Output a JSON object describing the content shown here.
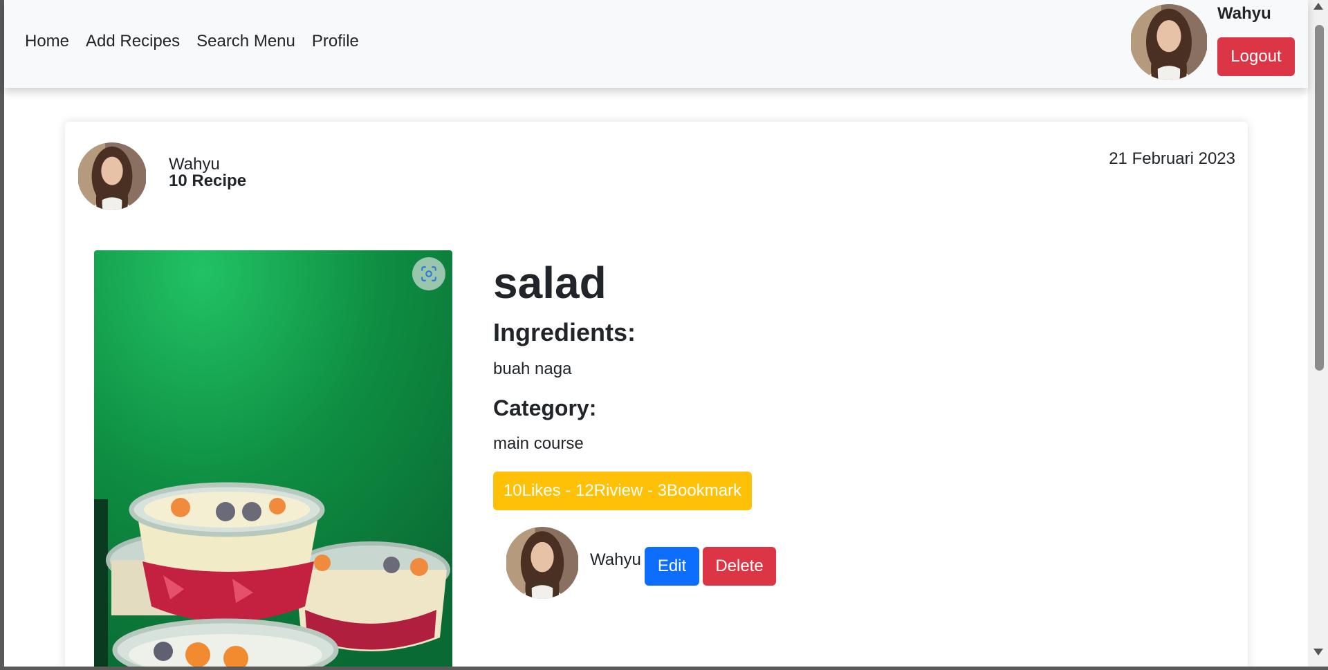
{
  "navbar": {
    "links": [
      "Home",
      "Add Recipes",
      "Search Menu",
      "Profile"
    ],
    "username": "Wahyu",
    "logout_label": "Logout"
  },
  "author": {
    "name": "Wahyu",
    "recipe_count": "10 Recipe",
    "date": "21 Februari 2023"
  },
  "recipe": {
    "title": "salad",
    "ingredients_heading": "Ingredients:",
    "ingredients": "buah naga",
    "category_heading": "Category:",
    "category": "main course",
    "stats": "10Likes - 12Riview - 3Bookmark"
  },
  "owner": {
    "name": "Wahyu",
    "edit_label": "Edit",
    "delete_label": "Delete"
  },
  "colors": {
    "danger": "#dc3545",
    "primary": "#0d6efd",
    "warning": "#ffc107",
    "navbar_bg": "#f8f9fa"
  },
  "icons": {
    "lens": "lens-scan-icon"
  }
}
